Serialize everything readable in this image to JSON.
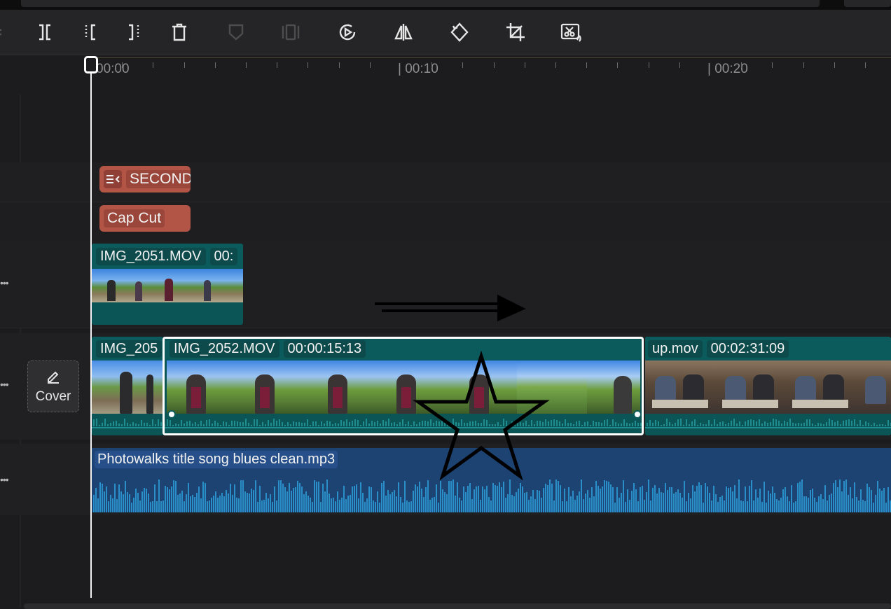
{
  "toolbar": {
    "tools": [
      {
        "name": "split-icon",
        "enabled": true
      },
      {
        "name": "trim-left-icon",
        "enabled": true
      },
      {
        "name": "trim-right-icon",
        "enabled": true
      },
      {
        "name": "delete-icon",
        "enabled": true
      },
      {
        "name": "mask-icon",
        "enabled": false
      },
      {
        "name": "freeze-icon",
        "enabled": false
      },
      {
        "name": "play-speed-icon",
        "enabled": true
      },
      {
        "name": "mirror-icon",
        "enabled": true
      },
      {
        "name": "rotate-icon",
        "enabled": true
      },
      {
        "name": "crop-icon",
        "enabled": true
      },
      {
        "name": "remove-audio-icon",
        "enabled": true
      }
    ]
  },
  "ruler": {
    "labels": [
      "00:00",
      "| 00:10",
      "| 00:20"
    ]
  },
  "tracks": {
    "text_clips": [
      {
        "label": "SECOND",
        "icon": "text-lines-icon"
      },
      {
        "label": "Cap Cut"
      }
    ],
    "overlay_clip": {
      "name": "IMG_2051.MOV",
      "duration": "00:"
    },
    "main_clips": [
      {
        "name": "IMG_205",
        "duration": ""
      },
      {
        "name": "IMG_2052.MOV",
        "duration": "00:00:15:13",
        "selected": true
      },
      {
        "name": "up.mov",
        "duration": "00:02:31:09"
      }
    ],
    "audio_clip": {
      "name": "Photowalks title song blues clean.mp3"
    }
  },
  "cover": {
    "label": "Cover",
    "icon": "pencil-icon"
  },
  "colors": {
    "accent_text_clip": "#b25446",
    "video_clip": "#0c5b5c",
    "audio_clip": "#1d4373",
    "waveform": "#2a8fc9"
  }
}
